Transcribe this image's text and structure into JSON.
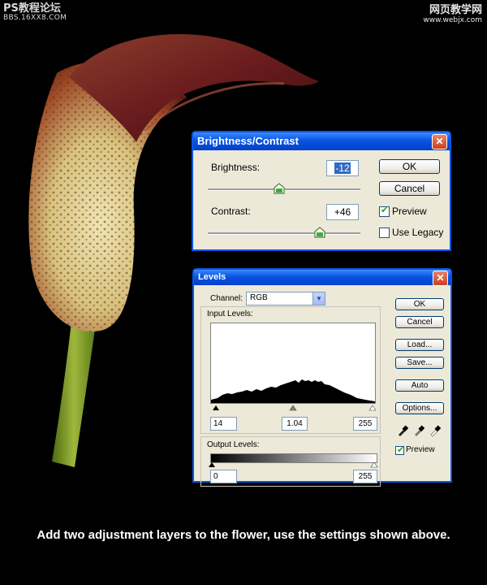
{
  "watermark_left": {
    "line1": "PS教程论坛",
    "line2": "BBS.16XX8.COM"
  },
  "watermark_right": {
    "line1": "网页教学网",
    "line2": "www.webjx.com"
  },
  "brightness_contrast": {
    "title": "Brightness/Contrast",
    "close_icon": "close-icon",
    "brightness_label": "Brightness:",
    "brightness_value": "-12",
    "contrast_label": "Contrast:",
    "contrast_value": "+46",
    "ok": "OK",
    "cancel": "Cancel",
    "preview": {
      "label": "Preview",
      "checked": true
    },
    "use_legacy": {
      "label": "Use Legacy",
      "checked": false
    }
  },
  "levels": {
    "title": "Levels",
    "close_icon": "close-icon",
    "channel_label": "Channel:",
    "channel_value": "RGB",
    "input_levels_label": "Input Levels:",
    "input_black": "14",
    "input_gamma": "1.04",
    "input_white": "255",
    "output_levels_label": "Output Levels:",
    "output_black": "0",
    "output_white": "255",
    "buttons": {
      "ok": "OK",
      "cancel": "Cancel",
      "load": "Load...",
      "save": "Save...",
      "auto": "Auto",
      "options": "Options..."
    },
    "eyedropper_icons": [
      "black-eyedropper-icon",
      "gray-eyedropper-icon",
      "white-eyedropper-icon"
    ],
    "preview": {
      "label": "Preview",
      "checked": true
    }
  },
  "caption": "Add two adjustment layers to the flower, use the settings shown above."
}
